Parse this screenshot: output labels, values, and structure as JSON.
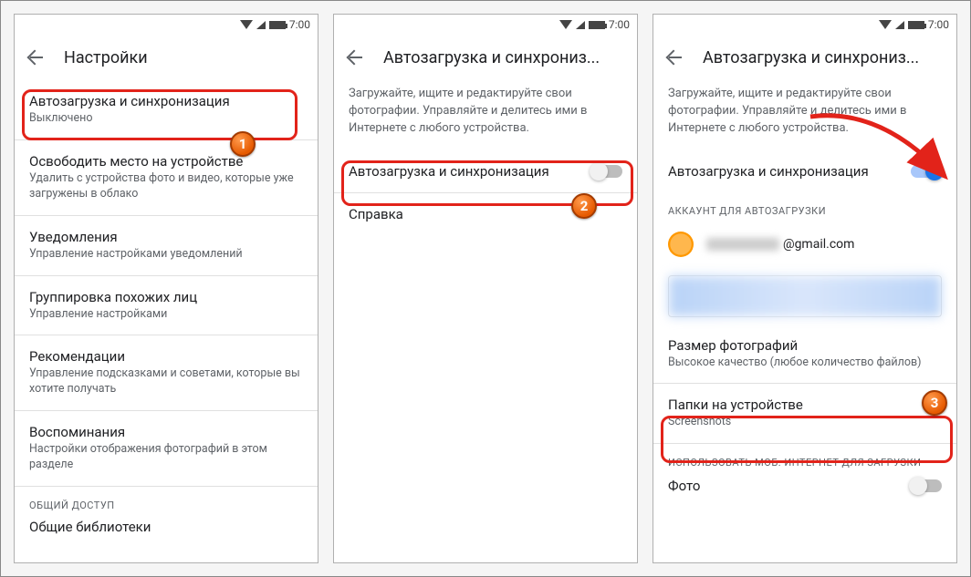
{
  "status": {
    "time": "7:00"
  },
  "screen1": {
    "title": "Настройки",
    "items": [
      {
        "title": "Автозагрузка и синхронизация",
        "sub": "Выключено"
      },
      {
        "title": "Освободить место на устройстве",
        "sub": "Удалить с устройства фото и видео, которые уже загружены в облако"
      },
      {
        "title": "Уведомления",
        "sub": "Управление настройками уведомлений"
      },
      {
        "title": "Группировка похожих лиц",
        "sub": "Управление настройками"
      },
      {
        "title": "Рекомендации",
        "sub": "Управление подсказками и советами, которые вы хотите получать"
      },
      {
        "title": "Воспоминания",
        "sub": "Настройки отображения фотографий в этом разделе"
      }
    ],
    "section": "ОБЩИЙ ДОСТУП",
    "shared_item": "Общие библиотеки"
  },
  "screen2": {
    "title": "Автозагрузка и синхрониз...",
    "desc": "Загружайте, ищите и редактируйте свои фотографии. Управляйте и делитесь ими в Интернете с любого устройства.",
    "toggle_label": "Автозагрузка и синхронизация",
    "help": "Справка"
  },
  "screen3": {
    "title": "Автозагрузка и синхрониз...",
    "desc": "Загружайте, ищите и редактируйте свои фотографии. Управляйте и делитесь ими в Интернете с любого устройства.",
    "toggle_label": "Автозагрузка и синхронизация",
    "account_section": "АККАУНТ ДЛЯ АВТОЗАГРУЗКИ",
    "account_email_suffix": "@gmail.com",
    "size": {
      "title": "Размер фотографий",
      "sub": "Высокое качество (любое количество файлов)"
    },
    "folders": {
      "title": "Папки на устройстве",
      "sub": "Screenshots"
    },
    "mobile_section": "ИСПОЛЬЗОВАТЬ МОБ. ИНТЕРНЕТ ДЛЯ ЗАГРУЗКИ",
    "photo_label": "Фото"
  },
  "badges": {
    "b1": "1",
    "b2": "2",
    "b3": "3"
  }
}
